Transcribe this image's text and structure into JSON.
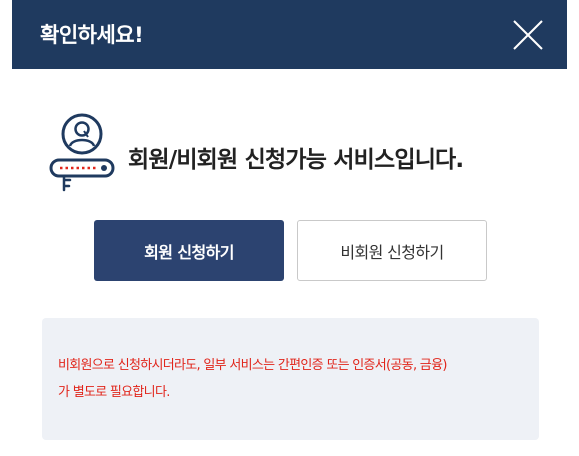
{
  "header": {
    "title": "확인하세요!",
    "close_icon": "close-icon"
  },
  "service": {
    "icon": "person-id-card-icon",
    "text": "회원/비회원 신청가능 서비스입니다."
  },
  "buttons": {
    "member_label": "회원 신청하기",
    "nonmember_label": "비회원 신청하기"
  },
  "notice": {
    "line1": "비회원으로 신청하시더라도, 일부 서비스는 간편인증 또는 인증서(공동, 금융)",
    "line2": "가 별도로 필요합니다."
  },
  "colors": {
    "header_bg": "#1f3a5f",
    "primary_button": "#2c4370",
    "notice_bg": "#eef1f6",
    "notice_text": "#e1251b"
  }
}
